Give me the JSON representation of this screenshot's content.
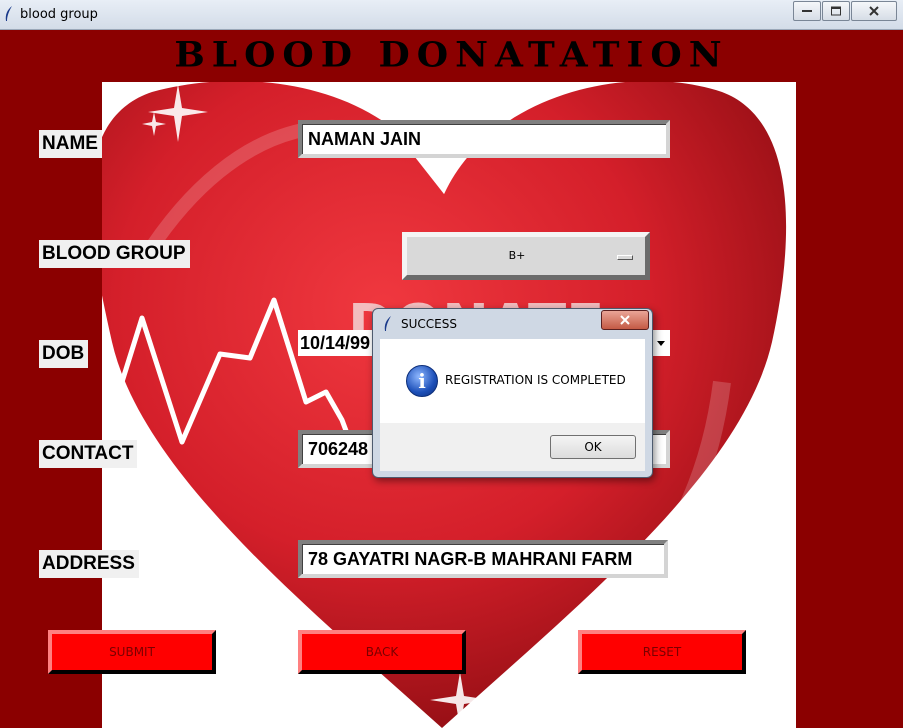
{
  "window": {
    "title": "blood group",
    "controls": [
      "minimize",
      "maximize",
      "close"
    ]
  },
  "banner": {
    "title": "BLOOD DONATATION"
  },
  "background_image": {
    "text": "DONATE",
    "icon": "heart-ecg-icon"
  },
  "form": {
    "labels": {
      "name": "NAME",
      "blood_group": "BLOOD GROUP",
      "dob": "DOB",
      "contact": "CONTACT",
      "address": "ADDRESS"
    },
    "values": {
      "name": "NAMAN JAIN",
      "blood_group": "B+",
      "dob": "10/14/99",
      "contact": "706248",
      "address": "78 GAYATRI NAGR-B MAHRANI FARM"
    }
  },
  "buttons": {
    "submit": "SUBMIT",
    "back": "BACK",
    "reset": "RESET"
  },
  "dialog": {
    "title": "SUCCESS",
    "message": "REGISTRATION IS COMPLETED",
    "ok": "OK",
    "icon": "info-icon"
  },
  "colors": {
    "background": "#8b0000",
    "button": "#ff0000",
    "heart": "#d9232e"
  }
}
